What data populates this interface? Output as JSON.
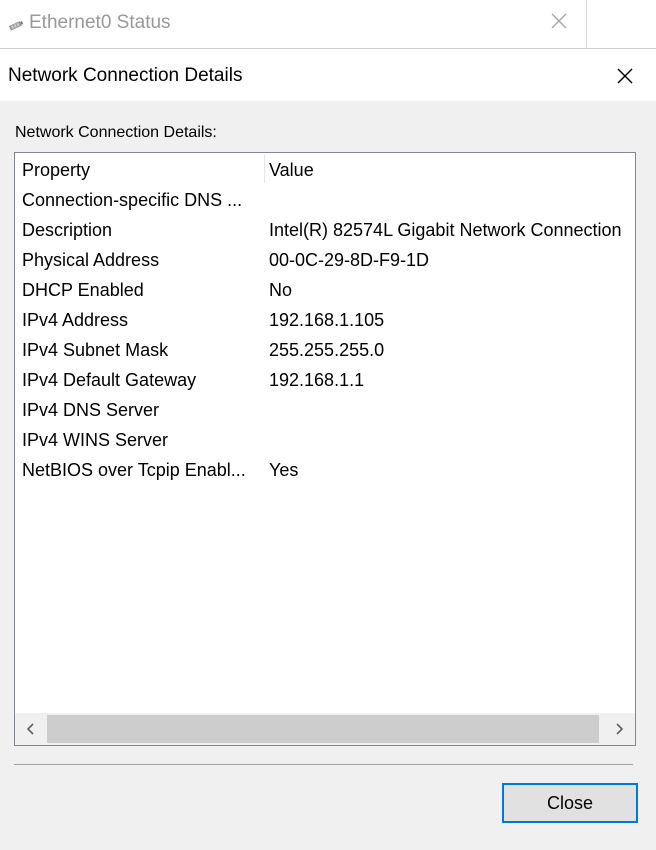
{
  "parent_window": {
    "title": "Ethernet0 Status"
  },
  "dialog": {
    "title": "Network Connection Details",
    "section_label": "Network Connection Details:",
    "columns": [
      "Property",
      "Value"
    ],
    "rows": [
      {
        "property": "Connection-specific DNS ...",
        "value": ""
      },
      {
        "property": "Description",
        "value": "Intel(R) 82574L Gigabit Network Connection"
      },
      {
        "property": "Physical Address",
        "value": "00-0C-29-8D-F9-1D"
      },
      {
        "property": "DHCP Enabled",
        "value": "No"
      },
      {
        "property": "IPv4 Address",
        "value": "192.168.1.105"
      },
      {
        "property": "IPv4 Subnet Mask",
        "value": "255.255.255.0"
      },
      {
        "property": "IPv4 Default Gateway",
        "value": "192.168.1.1"
      },
      {
        "property": "IPv4 DNS Server",
        "value": ""
      },
      {
        "property": "IPv4 WINS Server",
        "value": ""
      },
      {
        "property": "NetBIOS over Tcpip Enabl...",
        "value": "Yes"
      }
    ],
    "close_button": "Close"
  },
  "icons": {
    "parent_icon": "network-adapter-icon",
    "parent_close": "close-icon",
    "dialog_close": "close-icon",
    "scroll_left": "chevron-left-icon",
    "scroll_right": "chevron-right-icon"
  },
  "colors": {
    "accent": "#0078d7",
    "dialog_background": "#f0f0f0",
    "disabled_text": "#999999"
  }
}
